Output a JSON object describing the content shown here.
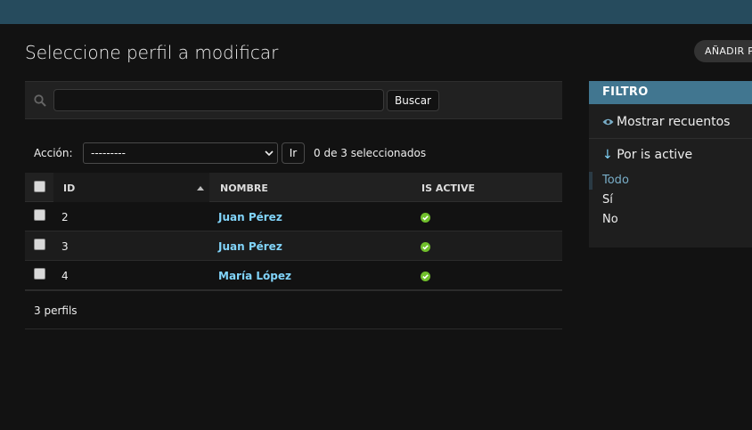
{
  "header": {
    "title": "Seleccione perfil a modificar",
    "add_button": "AÑADIR PERFIL"
  },
  "search": {
    "placeholder": "",
    "value": "",
    "button": "Buscar"
  },
  "actions": {
    "label": "Acción:",
    "selected_option": "---------",
    "go_button": "Ir",
    "selected_count": "0 de 3 seleccionados"
  },
  "table": {
    "columns": [
      "ID",
      "NOMBRE",
      "IS ACTIVE"
    ],
    "rows": [
      {
        "id": "2",
        "nombre": "Juan Pérez",
        "is_active": true
      },
      {
        "id": "3",
        "nombre": "Juan Pérez",
        "is_active": true
      },
      {
        "id": "4",
        "nombre": "María López",
        "is_active": true
      }
    ],
    "footer": "3 perfils"
  },
  "filter": {
    "header": "FILTRO",
    "show_counts": "Mostrar recuentos",
    "title": "Por is active",
    "title_arrow": "↓",
    "choices": [
      "Todo",
      "Sí",
      "No"
    ],
    "selected_choice": "Todo"
  },
  "colors": {
    "topbar": "#264b5d",
    "filter_header": "#417690",
    "link": "#81d4fa",
    "active_icon": "#70bf2b"
  }
}
